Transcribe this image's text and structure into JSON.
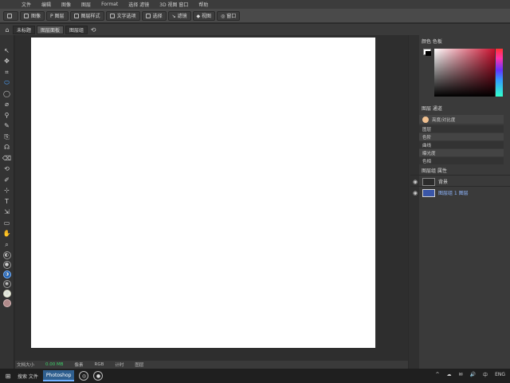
{
  "menu": [
    "文件",
    "编辑",
    "图像",
    "图层",
    "Format",
    "选择 滤镜",
    "3D 视图 窗口",
    "帮助"
  ],
  "options": {
    "buttons": [
      "",
      "图像",
      "P 图层",
      "图层样式",
      "文字选项",
      "选择",
      "↘ 滤镜",
      "◆ 视图",
      "◎ 窗口"
    ]
  },
  "tabs": {
    "home_icon": "⌂",
    "items": [
      "未标题",
      "图层面板",
      "图层组",
      "⟲"
    ],
    "active_index": 1
  },
  "tools": [
    "↖",
    "✥",
    "⌗",
    "⬭",
    "◯",
    "⌀",
    "⚲",
    "✎",
    "⎘",
    "☊",
    "⌫",
    "⟲",
    "✐",
    "⊹",
    "T",
    "⇲",
    "▭",
    "✋",
    "⌕",
    "◐",
    "●",
    "◑",
    "◉",
    "◍"
  ],
  "statusbar": [
    "文档大小",
    "0.00 MB",
    "像素",
    "RGB",
    "计时",
    "图层"
  ],
  "panels": {
    "color_title": "颜色 色板",
    "layers_title": "图层 通道",
    "adjust_rows": [
      "亮度/对比度",
      "图层",
      "色阶",
      "曲线",
      "曝光度",
      "色相"
    ],
    "bottom_label": "图层组 属性",
    "layers": [
      {
        "name": "背景",
        "selected": false
      },
      {
        "name": "图层组 1 图层",
        "selected": true
      }
    ]
  },
  "taskbar": {
    "start_icon": "⊞",
    "search_text": "搜索 文件",
    "app_label": "Photoshop",
    "tray": [
      "^",
      "☁",
      "✉",
      "🔊",
      "中",
      "ENG"
    ]
  },
  "colors": {
    "accent": "#2f5f8f",
    "selected_layer_text": "#8fb6ff",
    "status_green": "#3ecf6a"
  }
}
